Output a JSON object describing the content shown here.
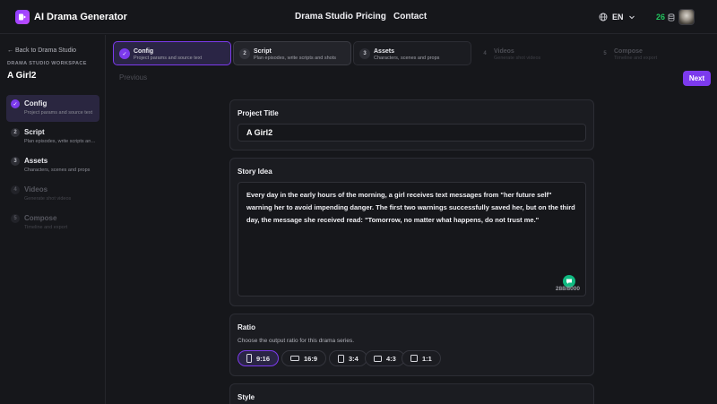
{
  "app": {
    "brand": "AI Drama Generator",
    "nav_links": [
      "Drama Studio",
      "Pricing",
      "Contact"
    ],
    "language": "EN",
    "credits": "26",
    "accent_color": "#7c3aed",
    "credits_color": "#22c55e"
  },
  "sidebar": {
    "back_label": "← Back to Drama Studio",
    "workspace_label": "DRAMA STUDIO WORKSPACE",
    "workspace_title": "A Girl2",
    "items": [
      {
        "num": "✓",
        "title": "Config",
        "subtitle": "Project params and source text",
        "state": "active"
      },
      {
        "num": "2",
        "title": "Script",
        "subtitle": "Plan episodes, write scripts and shots",
        "state": "enabled"
      },
      {
        "num": "3",
        "title": "Assets",
        "subtitle": "Characters, scenes and props",
        "state": "enabled"
      },
      {
        "num": "4",
        "title": "Videos",
        "subtitle": "Generate shot videos",
        "state": "disabled"
      },
      {
        "num": "5",
        "title": "Compose",
        "subtitle": "Timeline and export",
        "state": "disabled"
      }
    ]
  },
  "stepper": {
    "steps": [
      {
        "num": "✓",
        "title": "Config",
        "subtitle": "Project params and source text",
        "state": "active"
      },
      {
        "num": "2",
        "title": "Script",
        "subtitle": "Plan episodes, write scripts and shots",
        "state": "done"
      },
      {
        "num": "3",
        "title": "Assets",
        "subtitle": "Characters, scenes and props",
        "state": "enabled"
      },
      {
        "num": "4",
        "title": "Videos",
        "subtitle": "Generate shot videos",
        "state": "disabled"
      },
      {
        "num": "5",
        "title": "Compose",
        "subtitle": "Timeline and export",
        "state": "disabled"
      }
    ],
    "previous_label": "Previous",
    "next_label": "Next"
  },
  "form": {
    "project_title_label": "Project Title",
    "project_title_value": "A Girl2",
    "story_label": "Story Idea",
    "story_value": "Every day in the early hours of the morning, a girl receives text messages from \"her future self\" warning her to avoid impending danger. The first two warnings successfully saved her, but on the third day, the message she received read: \"Tomorrow, no matter what happens, do not trust me.\"",
    "story_count": "288/8000",
    "ratio_label": "Ratio",
    "ratio_desc": "Choose the output ratio for this drama series.",
    "ratio_options": [
      {
        "label": "9:16",
        "selected": true
      },
      {
        "label": "16:9",
        "selected": false
      },
      {
        "label": "3:4",
        "selected": false
      },
      {
        "label": "4:3",
        "selected": false
      },
      {
        "label": "1:1",
        "selected": false
      }
    ],
    "style_label": "Style"
  }
}
